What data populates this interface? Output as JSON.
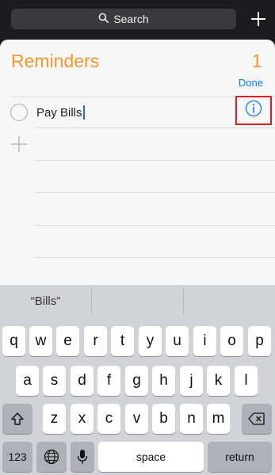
{
  "topbar": {
    "search_label": "Search",
    "search_icon": "magnifier",
    "add_icon": "plus"
  },
  "list": {
    "title": "Reminders",
    "count": "1",
    "done_label": "Done",
    "item_text": "Pay Bills",
    "accent_color": "#f7962d",
    "link_color": "#0a7aff",
    "info_highlight_color": "#e11b22"
  },
  "keyboard": {
    "suggestions": [
      "“Bills”",
      "",
      ""
    ],
    "row1": [
      "q",
      "w",
      "e",
      "r",
      "t",
      "y",
      "u",
      "i",
      "o",
      "p"
    ],
    "row2": [
      "a",
      "s",
      "d",
      "f",
      "g",
      "h",
      "j",
      "k",
      "l"
    ],
    "row3": [
      "z",
      "x",
      "c",
      "v",
      "b",
      "n",
      "m"
    ],
    "numbers_label": "123",
    "space_label": "space",
    "return_label": "return"
  }
}
